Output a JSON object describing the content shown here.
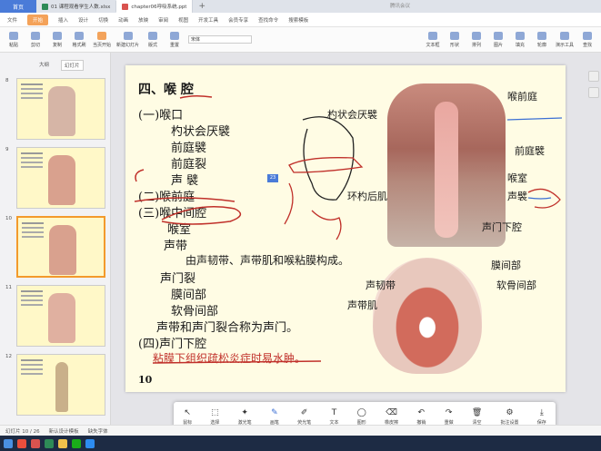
{
  "tabs": {
    "home": "首页",
    "docs": [
      {
        "label": "01 课程观看学生人数.xlsx",
        "color": "#2e8b57"
      },
      {
        "label": "chapter06呼吸系统.ppt",
        "color": "#d9534f"
      }
    ],
    "plus": "+",
    "meeting": "腾讯会议"
  },
  "menu": [
    "文件",
    "开始",
    "插入",
    "设计",
    "切换",
    "动画",
    "放映",
    "审阅",
    "视图",
    "开发工具",
    "会员专享",
    "查找命令",
    "搜索模板"
  ],
  "menu_active": "开始",
  "ribbon": {
    "buttons": [
      "粘贴",
      "剪切",
      "复制",
      "格式刷",
      "当页开始",
      "新建幻灯片",
      "版式",
      "重置"
    ],
    "font_value": "宋体",
    "right_buttons": [
      "文本框",
      "形状",
      "排列",
      "图片",
      "填充",
      "轮廓",
      "演示工具",
      "查找"
    ]
  },
  "panel": {
    "tabs": [
      "大纲",
      "幻灯片"
    ],
    "active": "幻灯片",
    "slides": [
      {
        "num": "8"
      },
      {
        "num": "9"
      },
      {
        "num": "10"
      },
      {
        "num": "11"
      },
      {
        "num": "12"
      }
    ]
  },
  "slide": {
    "title": "四、喉 腔",
    "lines": [
      "(一)喉口",
      "杓状会厌襞",
      "前庭襞",
      "前庭裂",
      "声 襞",
      "(二)喉前庭",
      "(三)喉中间腔",
      "喉室",
      "声带",
      "由声韧带、声带肌和喉粘膜构成。",
      "声门裂",
      "膜间部",
      "软骨间部",
      "声带和声门裂合称为声门。",
      "(四)声门下腔",
      "粘膜下组织疏松炎症时易水肿。"
    ],
    "page": "10",
    "top_labels": [
      "杓状会厌襞",
      "环杓后肌",
      "喉前庭",
      "前庭襞",
      "喉室",
      "声襞",
      "声门下腔"
    ],
    "bottom_labels": [
      "膜间部",
      "声韧带",
      "软骨间部",
      "声带肌"
    ],
    "badge": "23"
  },
  "toolbar": {
    "items": [
      {
        "label": "鼠标",
        "glyph": "↖"
      },
      {
        "label": "选择",
        "glyph": "⬚"
      },
      {
        "label": "激光笔",
        "glyph": "✦"
      },
      {
        "label": "画笔",
        "glyph": "✎"
      },
      {
        "label": "荧光笔",
        "glyph": "✐"
      },
      {
        "label": "文本",
        "glyph": "T"
      },
      {
        "label": "图形",
        "glyph": "◯"
      },
      {
        "label": "橡皮擦",
        "glyph": "⌫"
      },
      {
        "label": "撤销",
        "glyph": "↶"
      },
      {
        "label": "重做",
        "glyph": "↷"
      },
      {
        "label": "清空",
        "glyph": "🗑"
      },
      {
        "label": "批注设置",
        "glyph": "⚙"
      },
      {
        "label": "保存",
        "glyph": "⤓"
      }
    ],
    "selected": "画笔"
  },
  "status": {
    "slide_info": "幻灯片 10 / 26",
    "design": "新认设计模板",
    "font_warn": "缺失字体"
  },
  "colors": {
    "accent": "#f39a2b",
    "blue": "#4a7bd8",
    "ink": "#c0302a"
  }
}
